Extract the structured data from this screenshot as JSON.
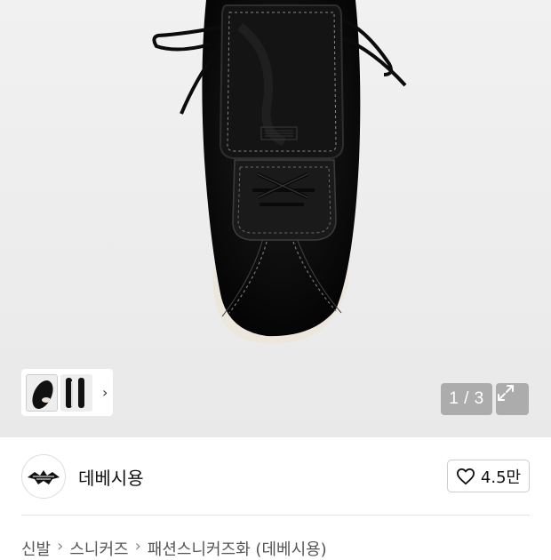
{
  "gallery": {
    "counter": "1 / 3",
    "thumbnail_chevron": "chevron-right-icon",
    "expand_icon": "expand-arrows-icon"
  },
  "seller": {
    "name": "데베시용",
    "avatar": "bird-logo-avatar",
    "like_icon": "heart-outline-icon",
    "like_count": "4.5만"
  },
  "breadcrumb": {
    "items": [
      "신발",
      "스니커즈",
      "패션스니커즈화 (데베시용)"
    ],
    "separator": "›"
  }
}
